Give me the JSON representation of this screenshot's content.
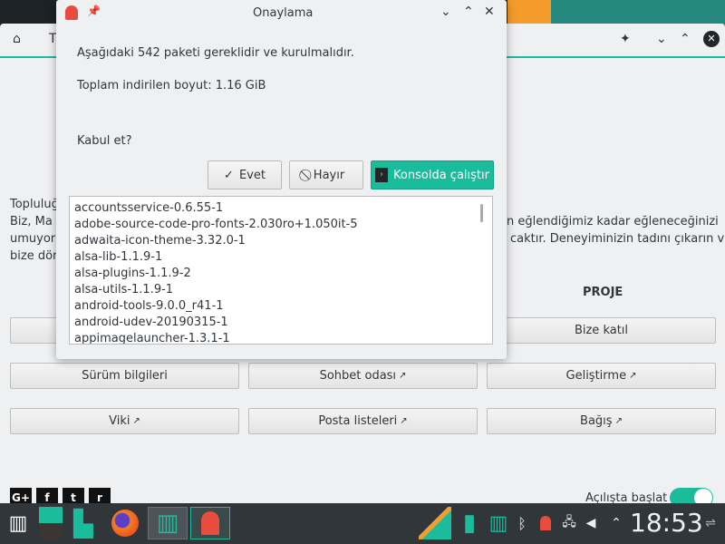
{
  "dialog": {
    "title": "Onaylama",
    "message": "Aşağıdaki 542 paketi gereklidir ve kurulmalıdır.",
    "size": "Toplam indirilen boyut: 1.16 GiB",
    "question": "Kabul et?",
    "yes": "Evet",
    "no": "Hayır",
    "console": "Konsolda çalıştır",
    "packages": [
      "accountsservice-0.6.55-1",
      "adobe-source-code-pro-fonts-2.030ro+1.050it-5",
      "adwaita-icon-theme-3.32.0-1",
      "alsa-lib-1.1.9-1",
      "alsa-plugins-1.1.9-2",
      "alsa-utils-1.1.9-1",
      "android-tools-9.0.0_r41-1",
      "android-udev-20190315-1",
      "appimagelauncher-1.3.1-1"
    ]
  },
  "window": {
    "title_fragment": "T",
    "text_left": [
      "Topluluğ",
      "Biz, Ma",
      "umuyor",
      "bize dön"
    ],
    "text_right": [
      "n eğlendiğimiz kadar eğleneceğinizi",
      "caktır. Deneyiminizin tadını çıkarın ve"
    ],
    "section_heading": "PROJE",
    "buttons": [
      "Bize katıl",
      "Sürüm bilgileri",
      "Sohbet odası",
      "Geliştirme",
      "Viki",
      "Posta listeleri",
      "Bağış"
    ],
    "autostart_label": "Açılışta başlat",
    "autostart_on": true,
    "social": [
      "G+",
      "f",
      "t",
      "r"
    ]
  },
  "taskbar": {
    "clock": "18:53"
  },
  "colors": {
    "accent": "#1abc9c",
    "taskbar": "#31363b"
  }
}
